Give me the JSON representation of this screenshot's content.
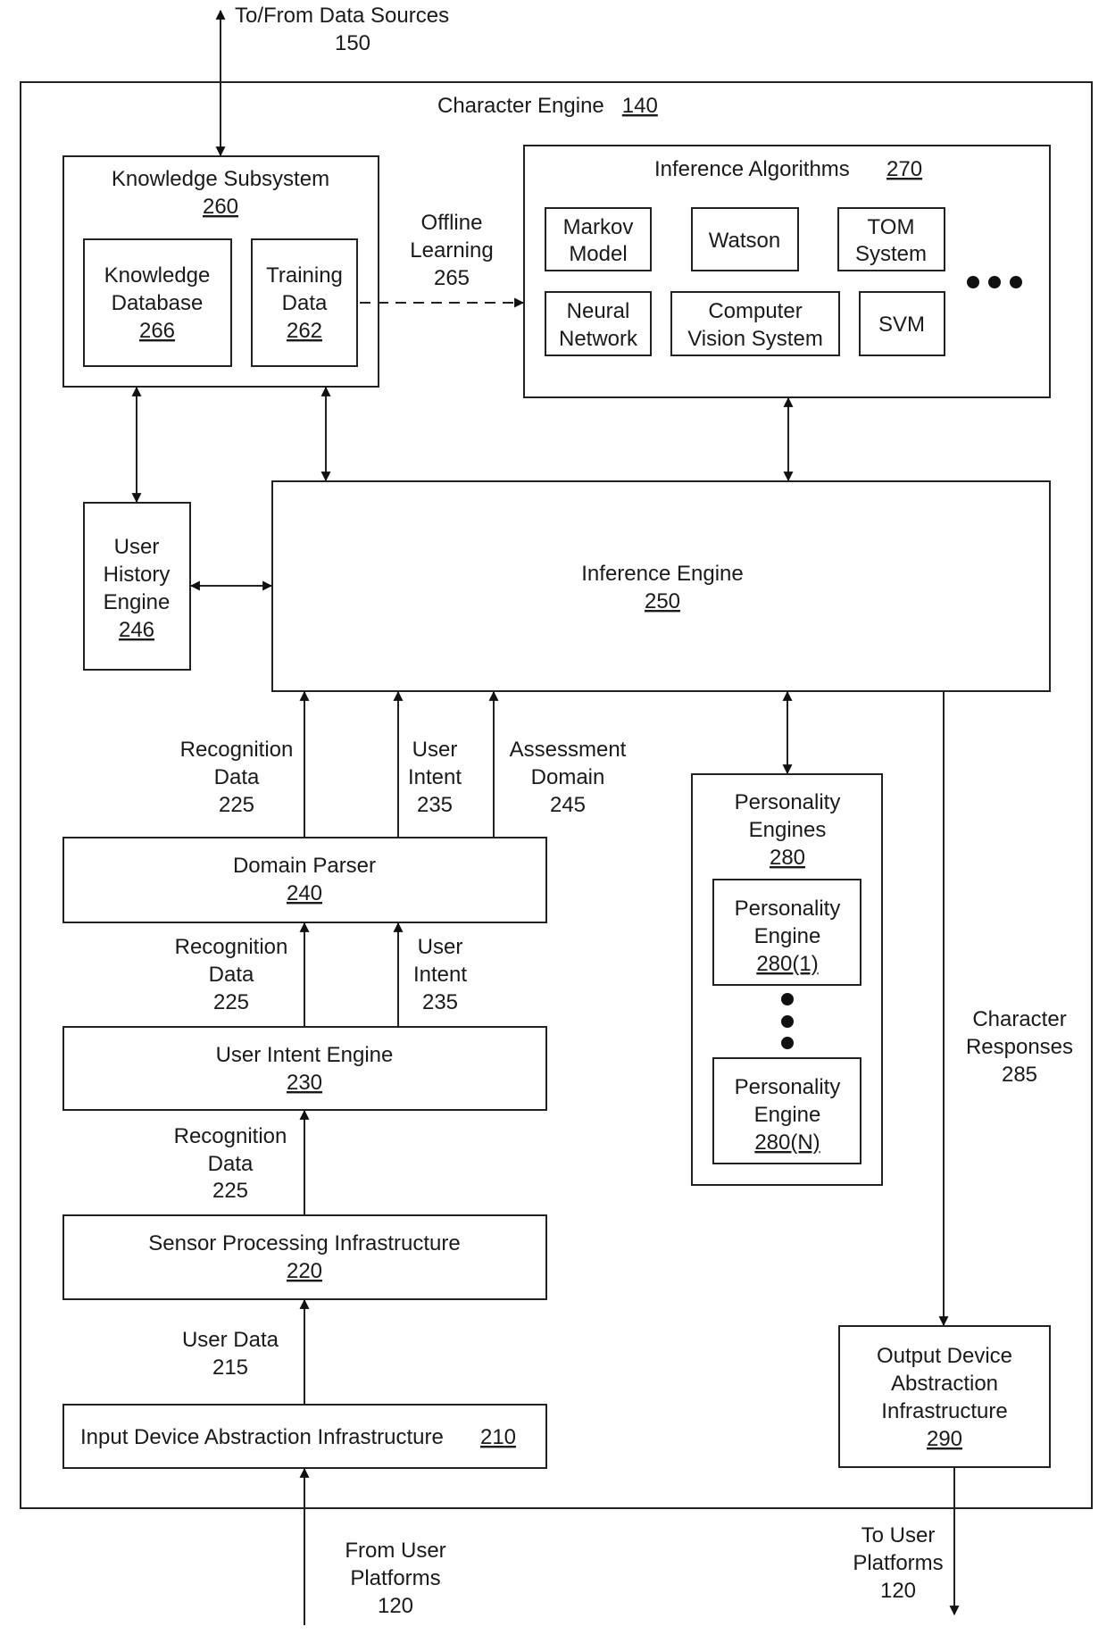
{
  "external": {
    "data_sources": [
      "To/From Data Sources",
      "150"
    ],
    "from_user_platforms": [
      "From User",
      "Platforms",
      "120"
    ],
    "to_user_platforms": [
      "To User",
      "Platforms",
      "120"
    ]
  },
  "character_engine": {
    "title": "Character Engine",
    "ref": "140"
  },
  "knowledge_subsystem": {
    "title": "Knowledge Subsystem",
    "ref": "260",
    "knowledge_database": {
      "lines": [
        "Knowledge",
        "Database"
      ],
      "ref": "266"
    },
    "training_data": {
      "lines": [
        "Training",
        "Data"
      ],
      "ref": "262"
    }
  },
  "offline_learning": [
    "Offline",
    "Learning",
    "265"
  ],
  "inference_algorithms": {
    "title": "Inference Algorithms",
    "ref": "270",
    "items": [
      {
        "lines": [
          "Markov",
          "Model"
        ]
      },
      {
        "lines": [
          "Watson"
        ]
      },
      {
        "lines": [
          "TOM",
          "System"
        ]
      },
      {
        "lines": [
          "Neural",
          "Network"
        ]
      },
      {
        "lines": [
          "Computer",
          "Vision System"
        ]
      },
      {
        "lines": [
          "SVM"
        ]
      }
    ],
    "more_indicator": "ellipsis"
  },
  "user_history_engine": {
    "lines": [
      "User",
      "History",
      "Engine"
    ],
    "ref": "246"
  },
  "inference_engine": {
    "title": "Inference Engine",
    "ref": "250"
  },
  "flows_to_inference": {
    "recognition_data": [
      "Recognition",
      "Data",
      "225"
    ],
    "user_intent": [
      "User",
      "Intent",
      "235"
    ],
    "assessment_domain": [
      "Assessment",
      "Domain",
      "245"
    ]
  },
  "domain_parser": {
    "title": "Domain Parser",
    "ref": "240"
  },
  "flows_to_domain_parser": {
    "recognition_data": [
      "Recognition",
      "Data",
      "225"
    ],
    "user_intent": [
      "User",
      "Intent",
      "235"
    ]
  },
  "user_intent_engine": {
    "title": "User Intent Engine",
    "ref": "230"
  },
  "flow_to_user_intent": {
    "recognition_data": [
      "Recognition",
      "Data",
      "225"
    ]
  },
  "sensor_processing": {
    "title": "Sensor Processing Infrastructure",
    "ref": "220"
  },
  "flow_to_sensor": {
    "user_data": [
      "User Data",
      "215"
    ]
  },
  "input_device_abstraction": {
    "title": "Input Device Abstraction Infrastructure",
    "ref": "210"
  },
  "personality_engines": {
    "lines": [
      "Personality",
      "Engines"
    ],
    "ref": "280",
    "engine_first": {
      "lines": [
        "Personality",
        "Engine"
      ],
      "ref": "280(1)"
    },
    "engine_last": {
      "lines": [
        "Personality",
        "Engine"
      ],
      "ref": "280(N)"
    }
  },
  "character_responses": [
    "Character",
    "Responses",
    "285"
  ],
  "output_device_abstraction": {
    "lines": [
      "Output Device",
      "Abstraction",
      "Infrastructure"
    ],
    "ref": "290"
  }
}
